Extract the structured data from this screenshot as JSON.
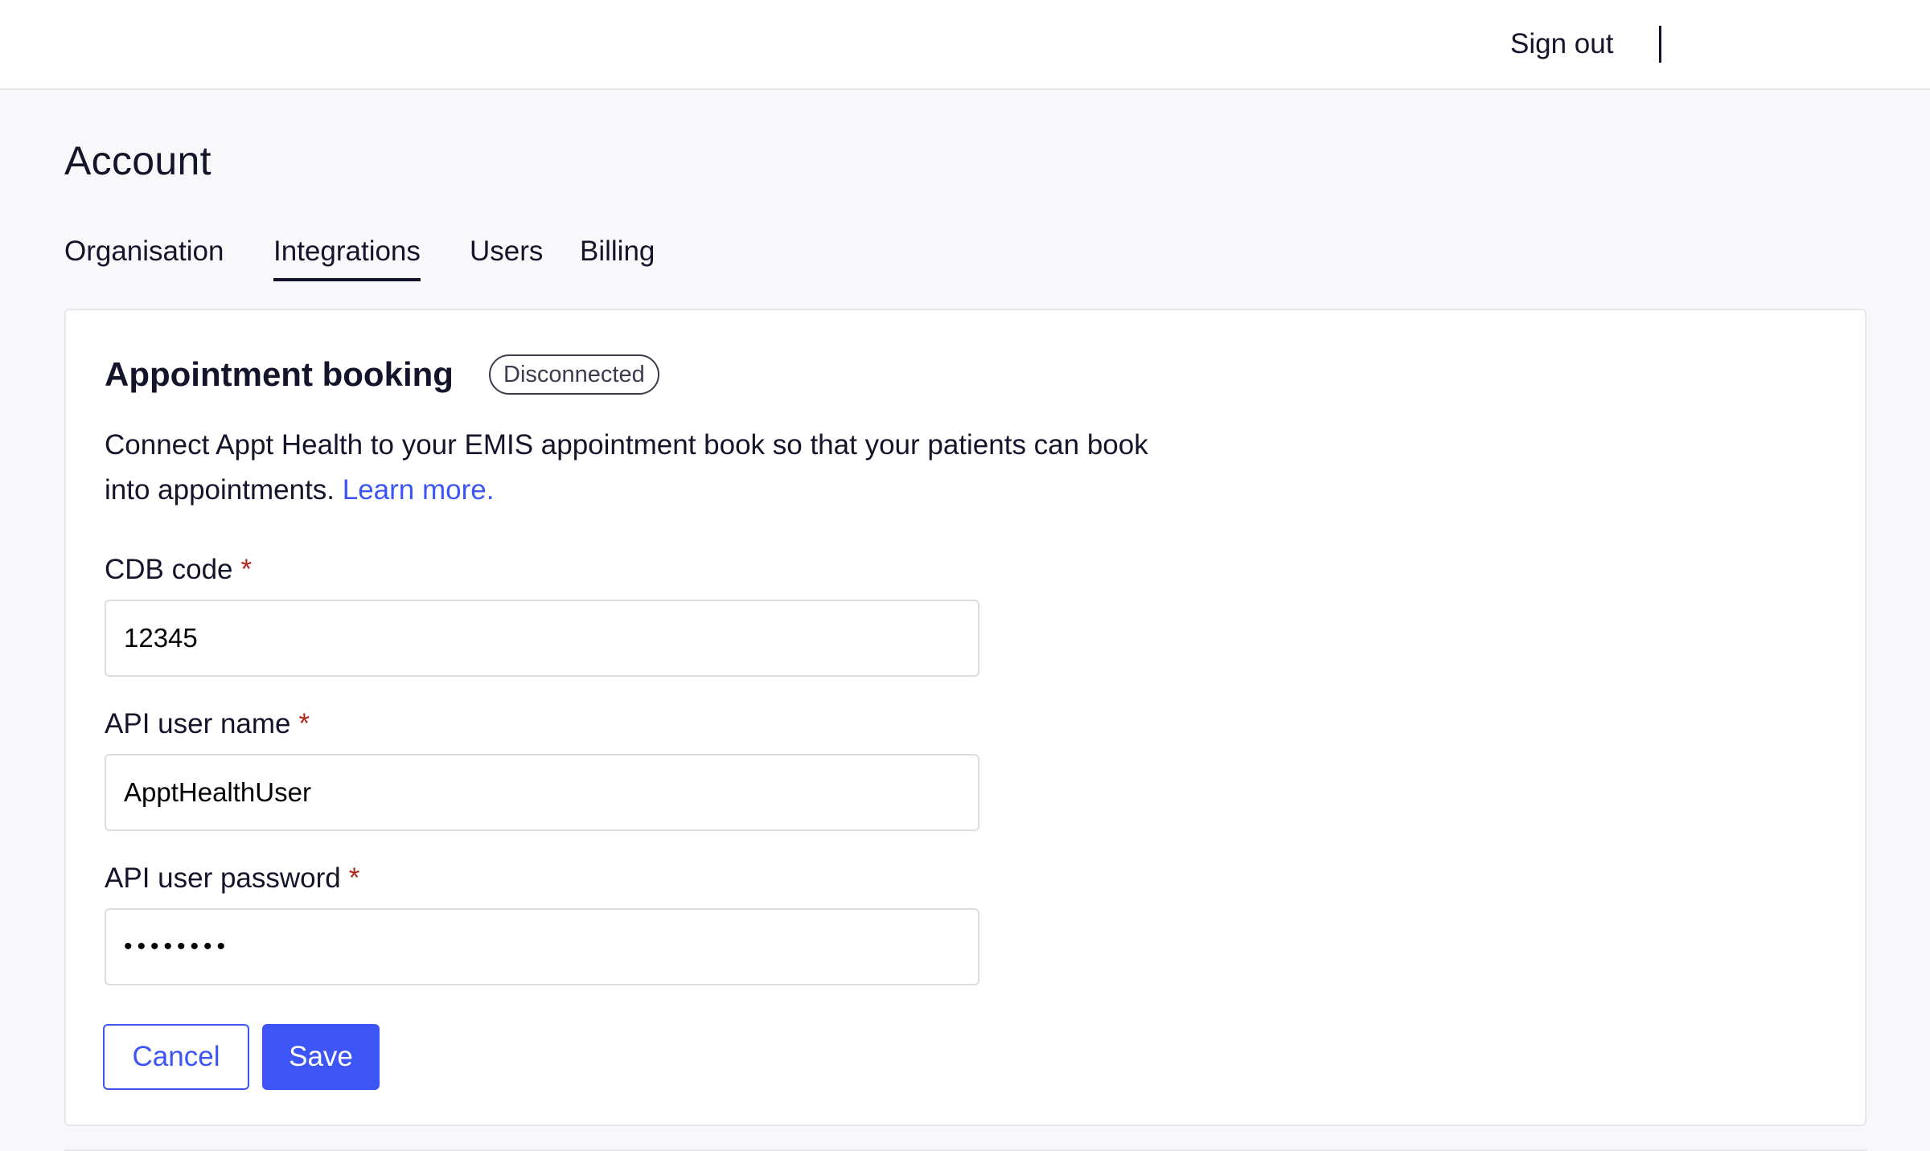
{
  "header": {
    "sign_out_label": "Sign out"
  },
  "page": {
    "title": "Account"
  },
  "tabs": [
    {
      "label": "Organisation",
      "active": false
    },
    {
      "label": "Integrations",
      "active": true
    },
    {
      "label": "Users",
      "active": false
    },
    {
      "label": "Billing",
      "active": false
    }
  ],
  "integration": {
    "title": "Appointment booking",
    "status": "Disconnected",
    "description": "Connect Appt Health to your EMIS appointment book so that your patients can book into appointments.",
    "learn_more_label": "Learn more.",
    "fields": {
      "cdb_code": {
        "label": "CDB code",
        "required_mark": "*",
        "value": "12345"
      },
      "api_user_name": {
        "label": "API user name",
        "required_mark": "*",
        "value": "ApptHealthUser"
      },
      "api_user_password": {
        "label": "API user password",
        "required_mark": "*",
        "value": "••••••••"
      }
    },
    "cancel_label": "Cancel",
    "save_label": "Save"
  },
  "colors": {
    "accent": "#3d55f5",
    "required": "#b3261e",
    "text": "#14142b",
    "background": "#f8f8fb"
  }
}
